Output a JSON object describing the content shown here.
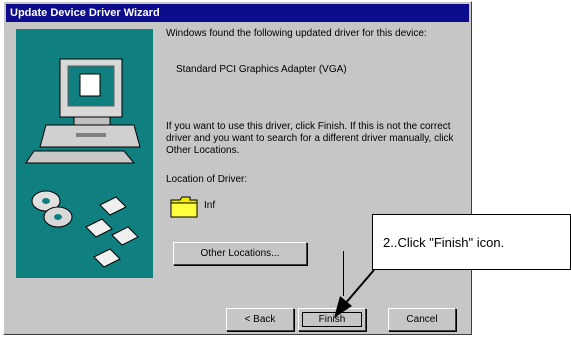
{
  "window": {
    "title": "Update Device Driver Wizard"
  },
  "wizard": {
    "found_text": "Windows found the following updated driver for this device:",
    "device_name": "Standard PCI Graphics Adapter (VGA)",
    "instructions": "If you want to use this driver, click Finish. If this is not the correct driver and you want to search for a different driver manually, click Other Locations.",
    "location_label": "Location of Driver:",
    "location_value": "Inf",
    "other_locations_button": "Other Locations...",
    "back_button": "< Back",
    "finish_button": "Finish",
    "cancel_button": "Cancel"
  },
  "annotation": {
    "text": "2..Click \"Finish\" icon."
  },
  "colors": {
    "title_bar": "#0c0c8c",
    "dialog_bg": "#c6c6c6",
    "art_bg": "#0f7f7f"
  },
  "icons": [
    "computer-icon",
    "cd-disc-icon",
    "floppy-disk-icon",
    "folder-icon",
    "arrow-icon"
  ]
}
